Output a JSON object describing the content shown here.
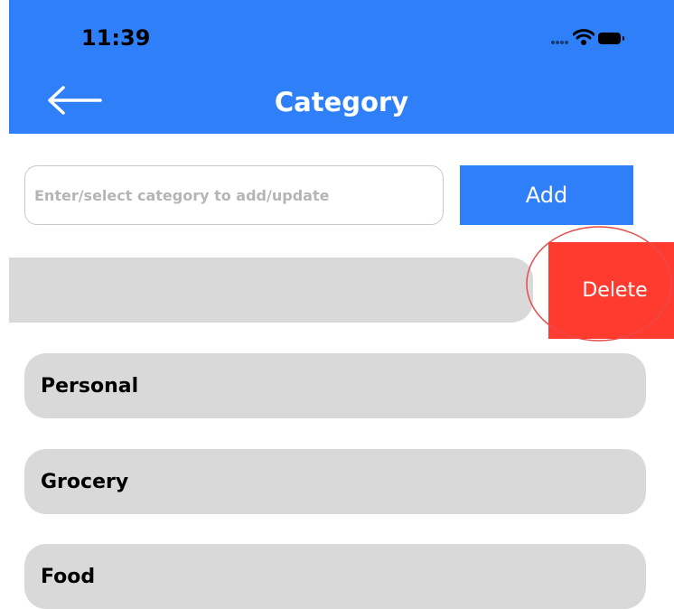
{
  "status_bar": {
    "time": "11:39"
  },
  "header": {
    "title": "Category"
  },
  "form": {
    "input_placeholder": "Enter/select category to add/update",
    "input_value": "",
    "add_label": "Add"
  },
  "swiped_item": {
    "label": "",
    "delete_label": "Delete"
  },
  "categories": [
    {
      "label": "Personal"
    },
    {
      "label": "Grocery"
    },
    {
      "label": "Food"
    }
  ],
  "colors": {
    "primary": "#2f80f8",
    "delete": "#ff3b30",
    "item_bg": "#d9d9d9"
  }
}
